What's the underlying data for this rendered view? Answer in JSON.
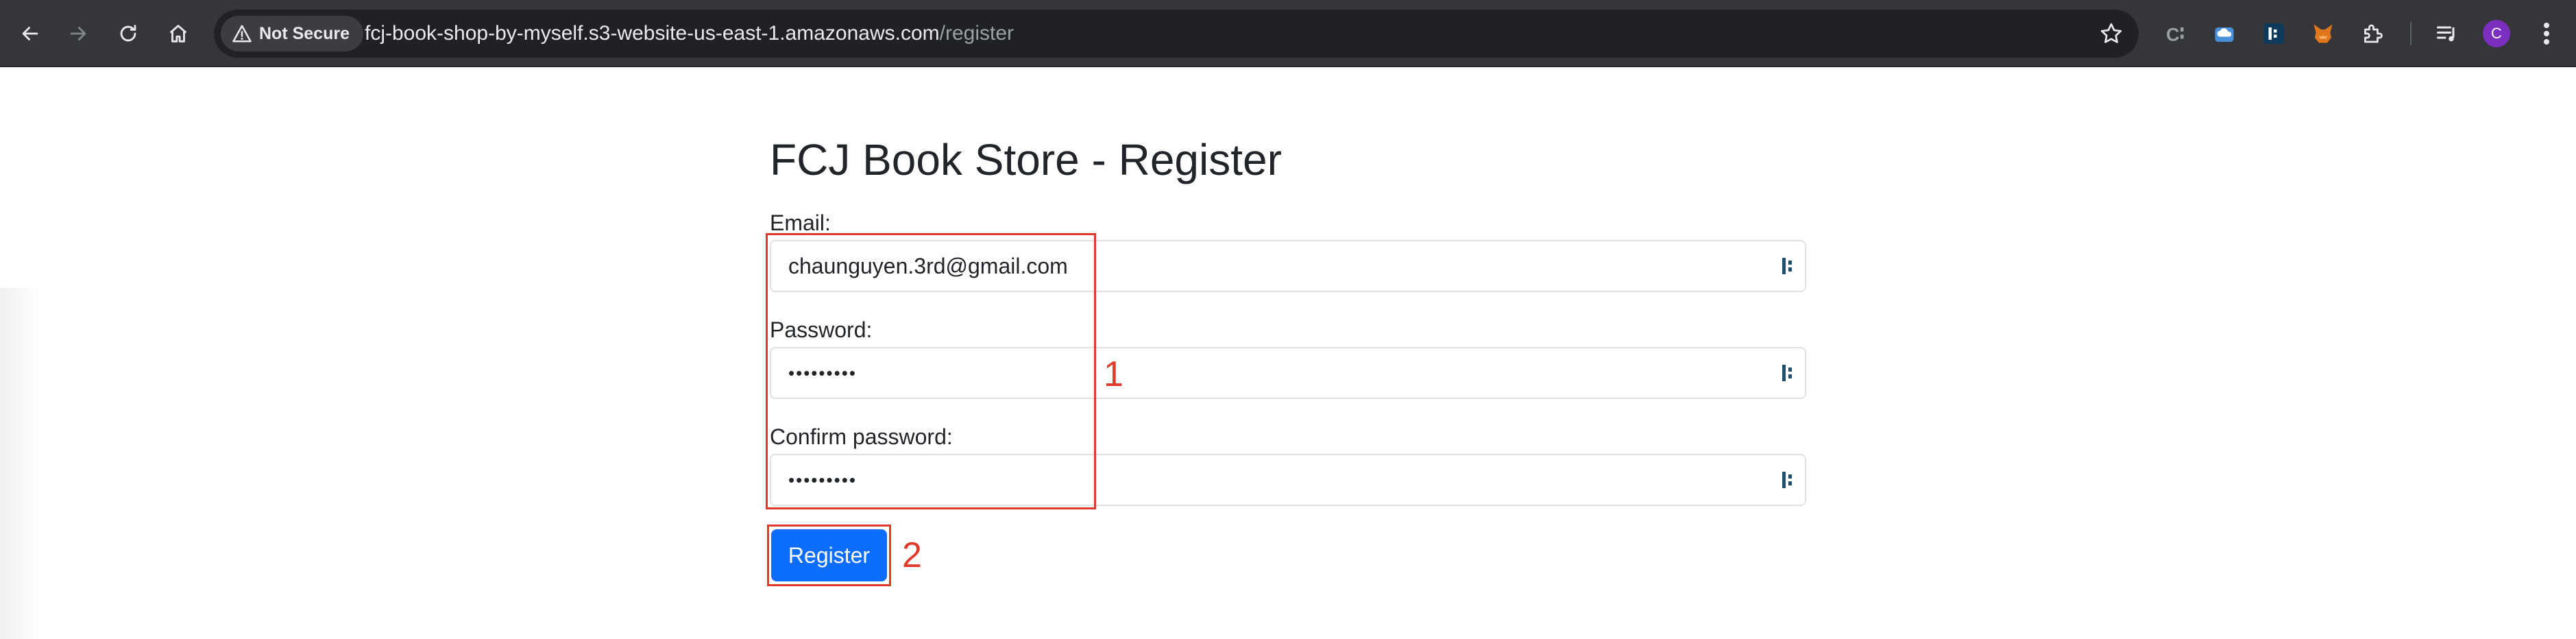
{
  "browser": {
    "security_label": "Not Secure",
    "url_host": "fcj-book-shop-by-myself.s3-website-us-east-1.amazonaws.com",
    "url_path": "/register",
    "profile_initial": "C",
    "extension_icons": [
      "extension-c-icon",
      "cloud-extension-icon",
      "dashlane-extension-icon",
      "metamask-fox-icon",
      "puzzle-extensions-icon"
    ],
    "colors": {
      "toolbar": "#35363a",
      "omnibox": "#202124",
      "avatar": "#7b2fbf"
    }
  },
  "page": {
    "title": "FCJ Book Store - Register",
    "email_label": "Email:",
    "email_value": "chaunguyen.3rd@gmail.com",
    "password_label": "Password:",
    "password_value": "•••••••••",
    "confirm_label": "Confirm password:",
    "confirm_value": "•••••••••",
    "register_button": "Register",
    "colors": {
      "primary": "#0d6efd",
      "annotation": "#e03a2a"
    }
  },
  "annotations": {
    "label_1": "1",
    "label_2": "2"
  }
}
